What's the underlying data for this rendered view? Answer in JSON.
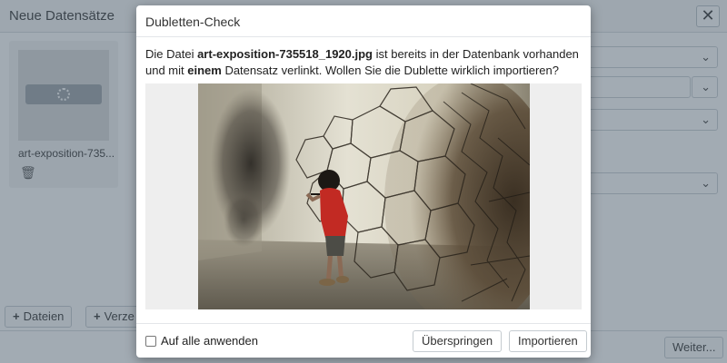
{
  "background": {
    "title": "Neue Datensätze",
    "close_label": "✕",
    "thumbnail": {
      "file_name": "art-exposition-735...",
      "delete_icon": "trash-icon"
    },
    "buttons": {
      "files_label": "Dateien",
      "second_label": "Verze",
      "next_label": "Weiter..."
    }
  },
  "dialog": {
    "title": "Dubletten-Check",
    "message": {
      "part1": "Die Datei ",
      "file_name": "art-exposition-735518_1920.jpg",
      "part2": " ist bereits in der Datenbank vorhanden und mit ",
      "emphasis": "einem",
      "part3": " Datensatz verlinkt. Wollen Sie die Dublette wirklich importieren?"
    },
    "apply_all_label": "Auf alle anwenden",
    "apply_all_checked": false,
    "skip_label": "Überspringen",
    "import_label": "Importieren"
  },
  "colors": {
    "overlay": "#465868",
    "modal_bg": "#ffffff"
  }
}
